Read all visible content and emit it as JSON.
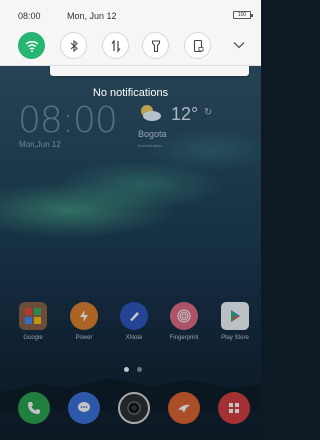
{
  "status_bar": {
    "time": "08:00",
    "date": "Mon, Jun 12",
    "battery": "100"
  },
  "quick_settings": {
    "toggles": [
      {
        "name": "wifi",
        "icon": "wifi-icon",
        "state": "on"
      },
      {
        "name": "bluetooth",
        "icon": "bluetooth-icon",
        "state": "off"
      },
      {
        "name": "mobile-data",
        "icon": "data-transfer-icon",
        "state": "off"
      },
      {
        "name": "flashlight",
        "icon": "flashlight-icon",
        "state": "off"
      },
      {
        "name": "auto-rotate",
        "icon": "rotate-lock-icon",
        "state": "off"
      }
    ],
    "expand_icon": "chevron-down-icon"
  },
  "notifications": {
    "empty_text": "No notifications"
  },
  "home": {
    "clock_time": "08:00",
    "clock_date": "Mon,Jun 12",
    "weather": {
      "temp": "12°",
      "city": "Bogota",
      "provider": "AccuWeather"
    },
    "apps": [
      {
        "label": "Google",
        "color": "#8a5a3a"
      },
      {
        "label": "Power",
        "color": "#e07a20"
      },
      {
        "label": "XNote",
        "color": "#2a4fb5"
      },
      {
        "label": "Fingerprint",
        "color": "#e0667a"
      },
      {
        "label": "Play Store",
        "color": "#f4f4f4"
      }
    ],
    "dock": [
      {
        "name": "phone",
        "color": "#29a34a"
      },
      {
        "name": "messages",
        "color": "#3a6fd8"
      },
      {
        "name": "camera",
        "color": "#2b2b2b"
      },
      {
        "name": "browser",
        "color": "#e2612a"
      },
      {
        "name": "theme-store",
        "color": "#d93a3a"
      }
    ]
  },
  "colors": {
    "accent": "#27b574",
    "shade_bg": "#f6f6f6"
  }
}
